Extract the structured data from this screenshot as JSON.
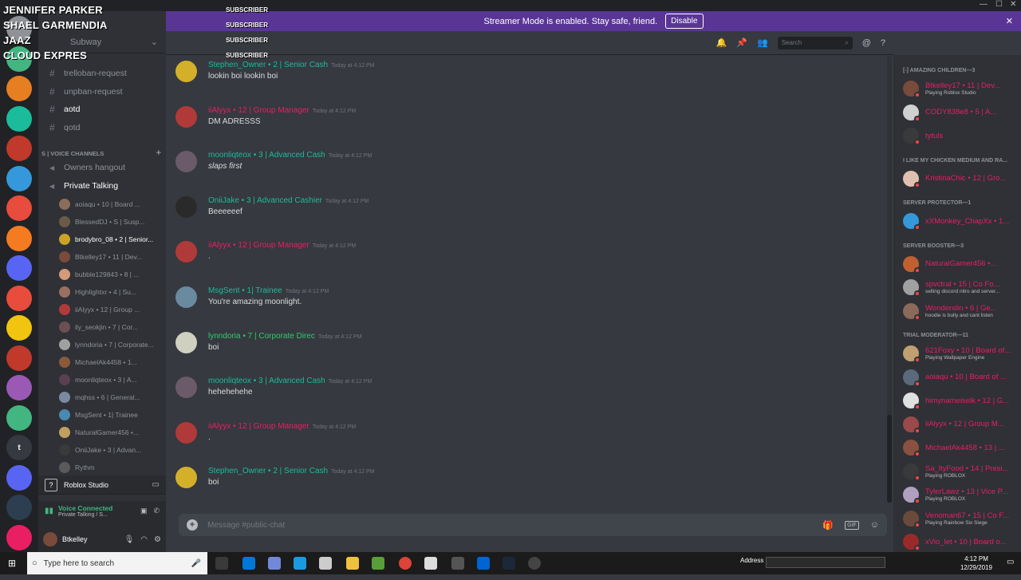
{
  "overlay": {
    "rows": [
      {
        "name": "JENNIFER PARKER",
        "tag": "SUBSCRIBER"
      },
      {
        "name": "SHAEL GARMENDIA",
        "tag": "SUBSCRIBER"
      },
      {
        "name": "JAAZ",
        "tag": "SUBSCRIBER"
      },
      {
        "name": "CLOUD EXPRES",
        "tag": "SUBSCRIBER"
      }
    ]
  },
  "banner": {
    "text": "Streamer Mode is enabled. Stay safe, friend.",
    "button": "Disable"
  },
  "server": {
    "name": "Subway",
    "channel_header": "public-chat"
  },
  "channels": [
    {
      "name": "trelloban-request",
      "bold": false
    },
    {
      "name": "unpban-request",
      "bold": false
    },
    {
      "name": "aotd",
      "bold": true
    },
    {
      "name": "qotd",
      "bold": false
    }
  ],
  "voice_category": "S | VOICE CHANNELS",
  "voice_channels": [
    {
      "name": "Owners hangout",
      "bold": false
    },
    {
      "name": "Private Talking",
      "bold": true
    }
  ],
  "voice_users": [
    {
      "name": "aoiaqu • 10 | Board ...",
      "bold": false
    },
    {
      "name": "BlessedDJ • S | Susp...",
      "bold": false
    },
    {
      "name": "brodybro_08 • 2 | Senior...",
      "bold": true
    },
    {
      "name": "Btkelley17 • 11 | Dev...",
      "bold": false
    },
    {
      "name": "bubble129843 • 8 | ...",
      "bold": false
    },
    {
      "name": "Highlightxr • 4 | Su...",
      "bold": false
    },
    {
      "name": "iiAlyyx • 12 | Group ...",
      "bold": false
    },
    {
      "name": "ily_seokjin • 7 | Cor...",
      "bold": false
    },
    {
      "name": "lynndoria • 7 | Corporate...",
      "bold": false
    },
    {
      "name": "MichaelAk4458 • 1...",
      "bold": false
    },
    {
      "name": "moonliqteox • 3 | A...",
      "bold": false
    },
    {
      "name": "mqhss • 6 | General...",
      "bold": false
    },
    {
      "name": "MsgSent • 1| Trainee",
      "bold": false
    },
    {
      "name": "NaturalGamer456 •...",
      "bold": false
    },
    {
      "name": "OniiJake • 3 | Advan...",
      "bold": false
    },
    {
      "name": "Rythm",
      "bold": false
    }
  ],
  "activity": {
    "label": "Roblox Studio"
  },
  "voice_panel": {
    "status": "Voice Connected",
    "location": "Private Talking / S..."
  },
  "user_panel": {
    "name": "Btkelley"
  },
  "search_placeholder": "Search",
  "messages": [
    {
      "author": "Stephen_Owner • 2 | Senior Cash",
      "time": "Today at 4:12 PM",
      "text": "lookin boi lookin boi",
      "color": "#1abc9c",
      "italic": false
    },
    {
      "author": "iiAlyyx • 12 | Group Manager",
      "time": "Today at 4:12 PM",
      "text": "DM ADRESSS",
      "color": "#e91e63",
      "italic": false
    },
    {
      "author": "moonliqteox • 3 | Advanced Cash",
      "time": "Today at 4:12 PM",
      "text": "slaps first",
      "color": "#1abc9c",
      "italic": true
    },
    {
      "author": "OniiJake • 3 | Advanced Cashier",
      "time": "Today at 4:12 PM",
      "text": "Beeeeeef",
      "color": "#1abc9c",
      "italic": false
    },
    {
      "author": "iiAlyyx • 12 | Group Manager",
      "time": "Today at 4:12 PM",
      "text": ".",
      "color": "#e91e63",
      "italic": false
    },
    {
      "author": "MsgSent • 1| Trainee",
      "time": "Today at 4:12 PM",
      "text": "You're amazing moonlight.",
      "color": "#1abc9c",
      "italic": false
    },
    {
      "author": "lynndoria • 7 | Corporate Direc",
      "time": "Today at 4:12 PM",
      "text": "boi",
      "color": "#2ecc71",
      "italic": false
    },
    {
      "author": "moonliqteox • 3 | Advanced Cash",
      "time": "Today at 4:12 PM",
      "text": "hehehehehe",
      "color": "#1abc9c",
      "italic": false
    },
    {
      "author": "iiAlyyx • 12 | Group Manager",
      "time": "Today at 4:12 PM",
      "text": ".",
      "color": "#e91e63",
      "italic": false
    },
    {
      "author": "Stephen_Owner • 2 | Senior Cash",
      "time": "Today at 4:12 PM",
      "text": "boi",
      "color": "#1abc9c",
      "italic": false
    }
  ],
  "composer_placeholder": "Message #public-chat",
  "member_groups": [
    {
      "title": "[-] AMAZING CHILDREN—3",
      "members": [
        {
          "name": "Btkelley17 • 11 | Dev...",
          "sub": "Playing Roblox Studio",
          "color": "#e91e63"
        },
        {
          "name": "CODY838e8 • 5 | A...",
          "sub": "",
          "color": "#e91e63"
        },
        {
          "name": "tytuls",
          "sub": "",
          "color": "#e91e63"
        }
      ]
    },
    {
      "title": "I LIKE MY CHICKEN MEDIUM AND RA...",
      "members": [
        {
          "name": "KristinaChic • 12 | Gro...",
          "sub": "",
          "color": "#e91e63"
        }
      ]
    },
    {
      "title": "SERVER PROTECTOR—1",
      "members": [
        {
          "name": "xXMonkey_ChapXx • 1...",
          "sub": "",
          "color": "#e91e63"
        }
      ]
    },
    {
      "title": "SERVER BOOSTER—3",
      "members": [
        {
          "name": "NaturalGamer456 •...",
          "sub": "",
          "color": "#e91e63"
        },
        {
          "name": "spvctral • 15 | Co Fo...",
          "sub": "selling discord nitro and server...",
          "color": "#e91e63"
        },
        {
          "name": "Wonderxlin • 6 | Ge...",
          "sub": "hoodie is bully and cant listen",
          "color": "#e91e63"
        }
      ]
    },
    {
      "title": "TRIAL MODERATOR—11",
      "members": [
        {
          "name": "621Foxy • 10 | Board of...",
          "sub": "Playing Wallpaper Engine",
          "color": "#e91e63"
        },
        {
          "name": "aoiaqu • 10 | Board of ...",
          "sub": "",
          "color": "#e91e63"
        },
        {
          "name": "himynameiselk • 12 | G...",
          "sub": "",
          "color": "#e91e63"
        },
        {
          "name": "iiAlyyx • 12 | Group M...",
          "sub": "",
          "color": "#e91e63"
        },
        {
          "name": "MichaelAk4458 • 13 | ...",
          "sub": "",
          "color": "#e91e63"
        },
        {
          "name": "Sa_ltyFood • 14 | Presi...",
          "sub": "Playing ROBLOX",
          "color": "#e91e63"
        },
        {
          "name": "TylerLawz • 13 | Vice P...",
          "sub": "Playing ROBLOX",
          "color": "#e91e63"
        },
        {
          "name": "Venoman67 • 15 | Co F...",
          "sub": "Playing Rainbow Six Siege",
          "color": "#e91e63"
        },
        {
          "name": "xVio_let • 10 | Board o...",
          "sub": "",
          "color": "#e91e63"
        }
      ]
    }
  ],
  "taskbar": {
    "search_placeholder": "Type here to search",
    "address_label": "Address",
    "time": "4:12 PM",
    "date": "12/29/2019"
  }
}
